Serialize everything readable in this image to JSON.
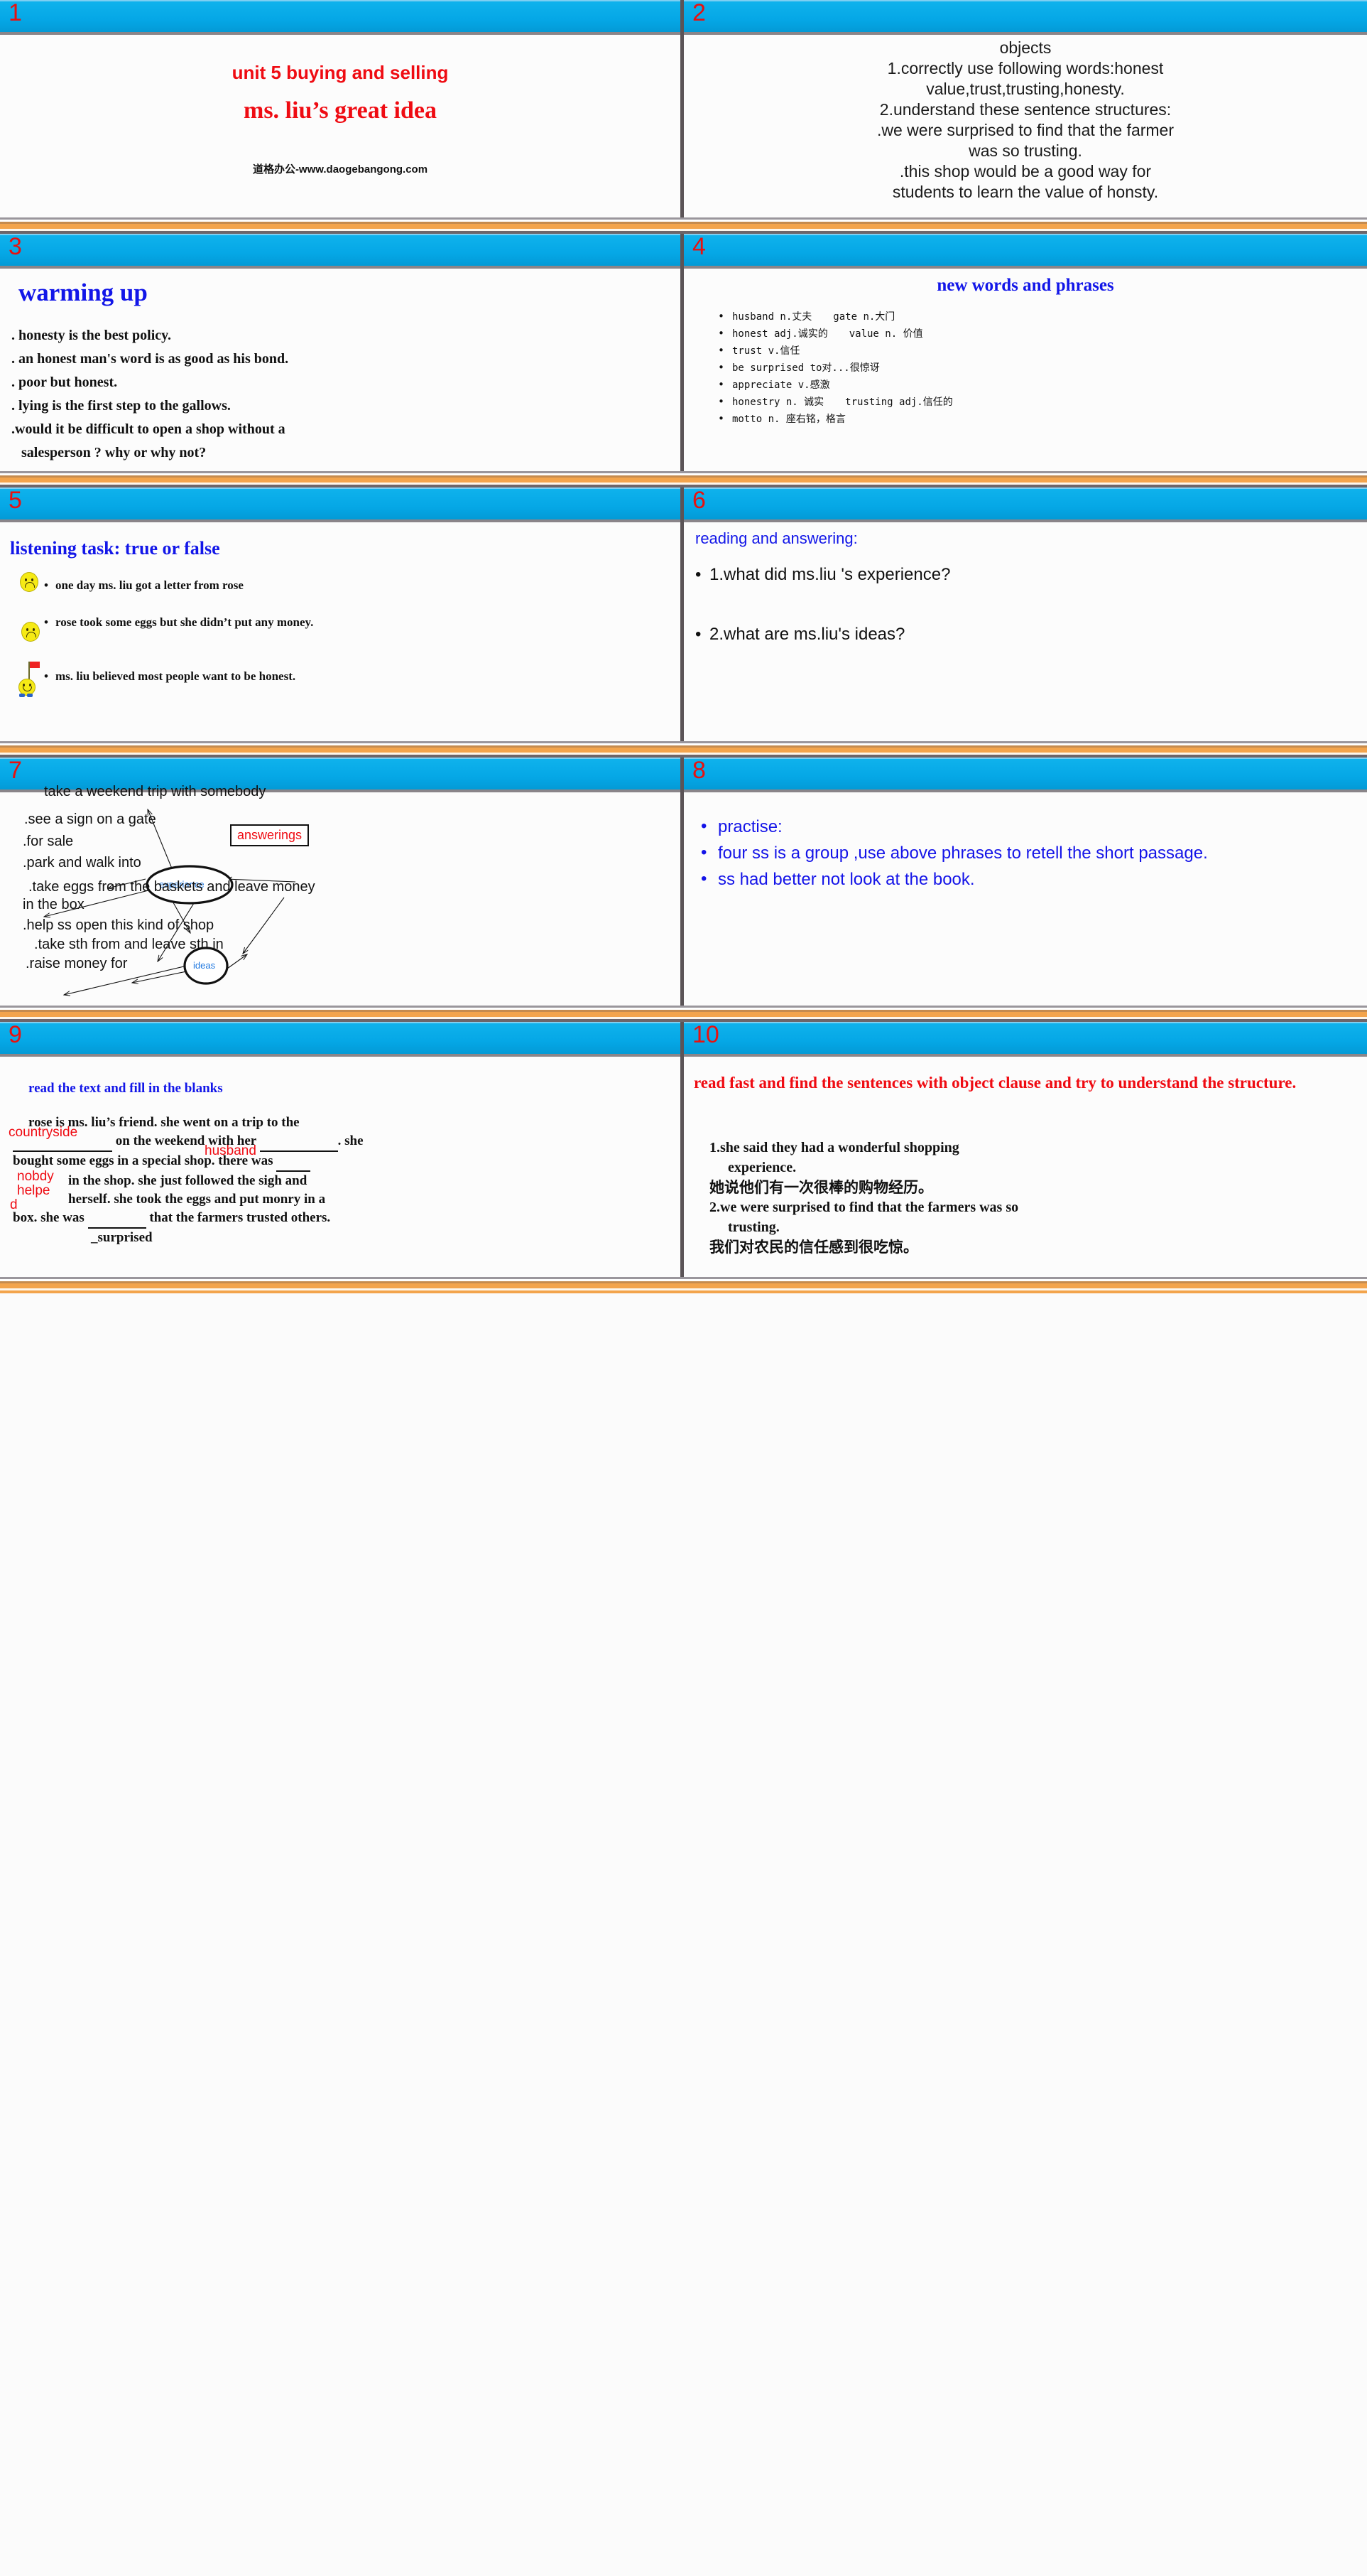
{
  "theme": {
    "header_blue": "#05a7e6",
    "accent_orange": "#f3a44c",
    "title_red": "#ef0b12",
    "heading_blue": "#1216e8",
    "divider_gray": "#5b5457"
  },
  "slides": [
    {
      "number": "1",
      "title": "unit 5  buying and selling",
      "subtitle": "ms. liu’s great idea",
      "watermark": "道格办公-www.daogebangong.com"
    },
    {
      "number": "2",
      "heading": "objects",
      "lines": [
        "1.correctly use following words:honest",
        "value,trust,trusting,honesty.",
        "2.understand these sentence structures:",
        ".we were surprised to find that the farmer",
        "was so trusting.",
        ".this shop would be a good way for",
        "students to learn the value of honsty."
      ]
    },
    {
      "number": "3",
      "title": "warming up",
      "items": [
        ".  honesty is the best policy.",
        ". an honest man's word is as good as his bond.",
        ". poor but honest.",
        ". lying is the first step to the gallows.",
        ".would  it be difficult to open a shop without a",
        "salesperson ? why or why not?"
      ]
    },
    {
      "number": "4",
      "title": "new words and phrases",
      "words": [
        {
          "left": "husband n.丈夫",
          "right": "gate n.大门"
        },
        {
          "left": "honest adj.诚实的",
          "right": "value  n. 价值"
        },
        {
          "left": "trust v.信任",
          "right": ""
        },
        {
          "left": "be surprised to对...很惊讶",
          "right": ""
        },
        {
          "left": "appreciate v.感激",
          "right": ""
        },
        {
          "left": "honestry  n. 诚实",
          "right": "trusting adj.信任的"
        },
        {
          "left": "motto n. 座右铭，格言",
          "right": ""
        }
      ]
    },
    {
      "number": "5",
      "title": "listening task: true or false",
      "items": [
        {
          "icon": "sad-face-icon",
          "text": "one day ms. liu got a letter from rose"
        },
        {
          "icon": "sad-face-icon",
          "text": "rose took some eggs but she didn’t put any money."
        },
        {
          "icon": "happy-face-with-flag-icon",
          "text": "ms. liu believed most people want to be honest."
        }
      ]
    },
    {
      "number": "6",
      "title": "reading and answering:",
      "questions": [
        "1.what did ms.liu 's experience?",
        "2.what are ms.liu's ideas?"
      ]
    },
    {
      "number": "7",
      "nodes": {
        "experience": "experiance",
        "ideas": "ideas",
        "answerings": "answerings"
      },
      "phrases": [
        "take a weekend trip with somebody",
        ".see a sign on a gate",
        ".for sale",
        ".park and walk into",
        ".take eggs from the baskets  and  leave money",
        "in the box",
        ".help ss open this kind of shop",
        ".take sth from  and leave sth in",
        ".raise money for"
      ]
    },
    {
      "number": "8",
      "items": [
        "practise:",
        "  four ss is a group ,use above phrases to retell the short passage.",
        " ss had better not look at the book."
      ]
    },
    {
      "number": "9",
      "title": "read the text and fill in the blanks",
      "paragraph_parts": {
        "p1": "rose is ms. liu’s friend. she went on a trip to the",
        "p2a": "on the weekend with her",
        "p2b": ". she",
        "p3": "bought some eggs in a special shop. there was",
        "p4": "in the shop. she just followed the sigh and",
        "p5": "herself. she took the eggs and put monry in a",
        "p6a": "box. she was",
        "p6b": "that the farmers trusted others.",
        "p7": "_surprised"
      },
      "answers": {
        "a1": "countryside",
        "a2": "husband",
        "a3": "nobdy",
        "a4": "helpe",
        "a5": "d"
      }
    },
    {
      "number": "10",
      "title": "read fast and find the sentences with object clause and try to understand the structure.",
      "lines": [
        "1.she said they had a wonderful shopping",
        "experience.",
        "她说他们有一次很棒的购物经历。",
        "2.we were surprised to find that the farmers was so",
        "trusting.",
        "我们对农民的信任感到很吃惊。"
      ]
    }
  ]
}
